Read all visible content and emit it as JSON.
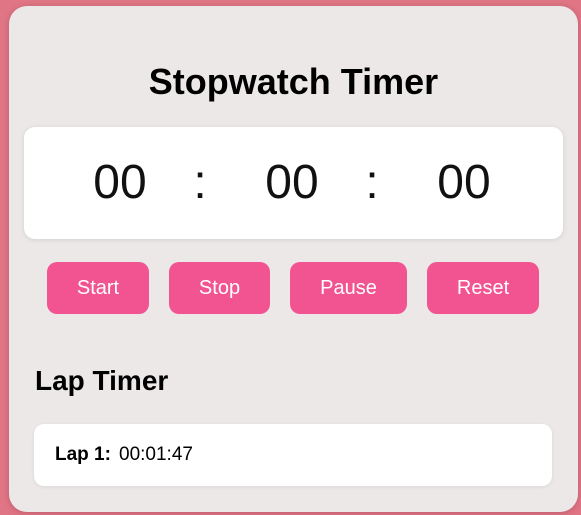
{
  "colors": {
    "page_background": "#df7585",
    "card_background": "#ede8e8",
    "button_color": "#f25491",
    "button_text": "#ffffff"
  },
  "stopwatch": {
    "title": "Stopwatch Timer",
    "hours": "00",
    "minutes": "00",
    "seconds": "00",
    "separator": ":"
  },
  "controls": {
    "start_label": "Start",
    "stop_label": "Stop",
    "pause_label": "Pause",
    "reset_label": "Reset"
  },
  "laps": {
    "heading": "Lap Timer",
    "items": [
      {
        "label": "Lap 1:",
        "time": "00:01:47"
      }
    ]
  }
}
